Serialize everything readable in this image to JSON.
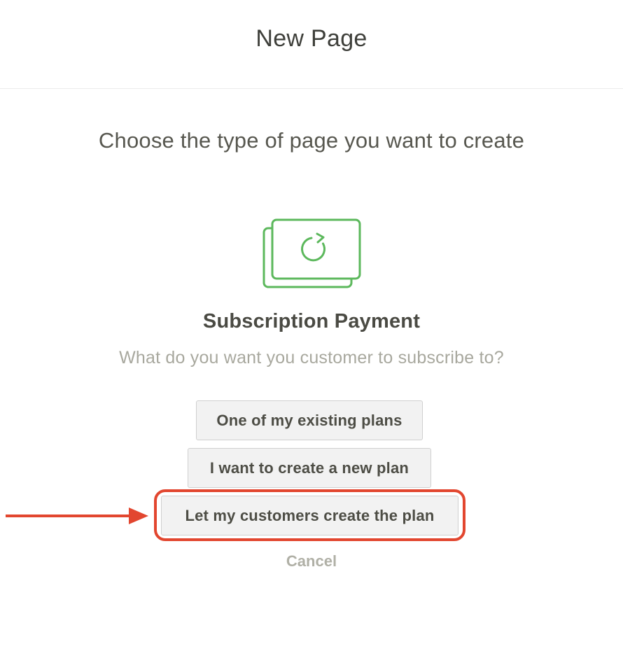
{
  "header": {
    "title": "New Page"
  },
  "prompt": "Choose the type of page you want to create",
  "page_type": {
    "icon": "subscription-refresh-icon",
    "accent_color": "#5cb85c",
    "title": "Subscription Payment",
    "question": "What do you want you customer to subscribe to?"
  },
  "options": [
    {
      "label": "One of my existing plans"
    },
    {
      "label": "I want to create a new plan"
    },
    {
      "label": "Let my customers create the plan",
      "highlighted": true
    }
  ],
  "cancel_label": "Cancel",
  "annotation": {
    "color": "#e2462f",
    "arrow_icon": "right-arrow-icon"
  }
}
